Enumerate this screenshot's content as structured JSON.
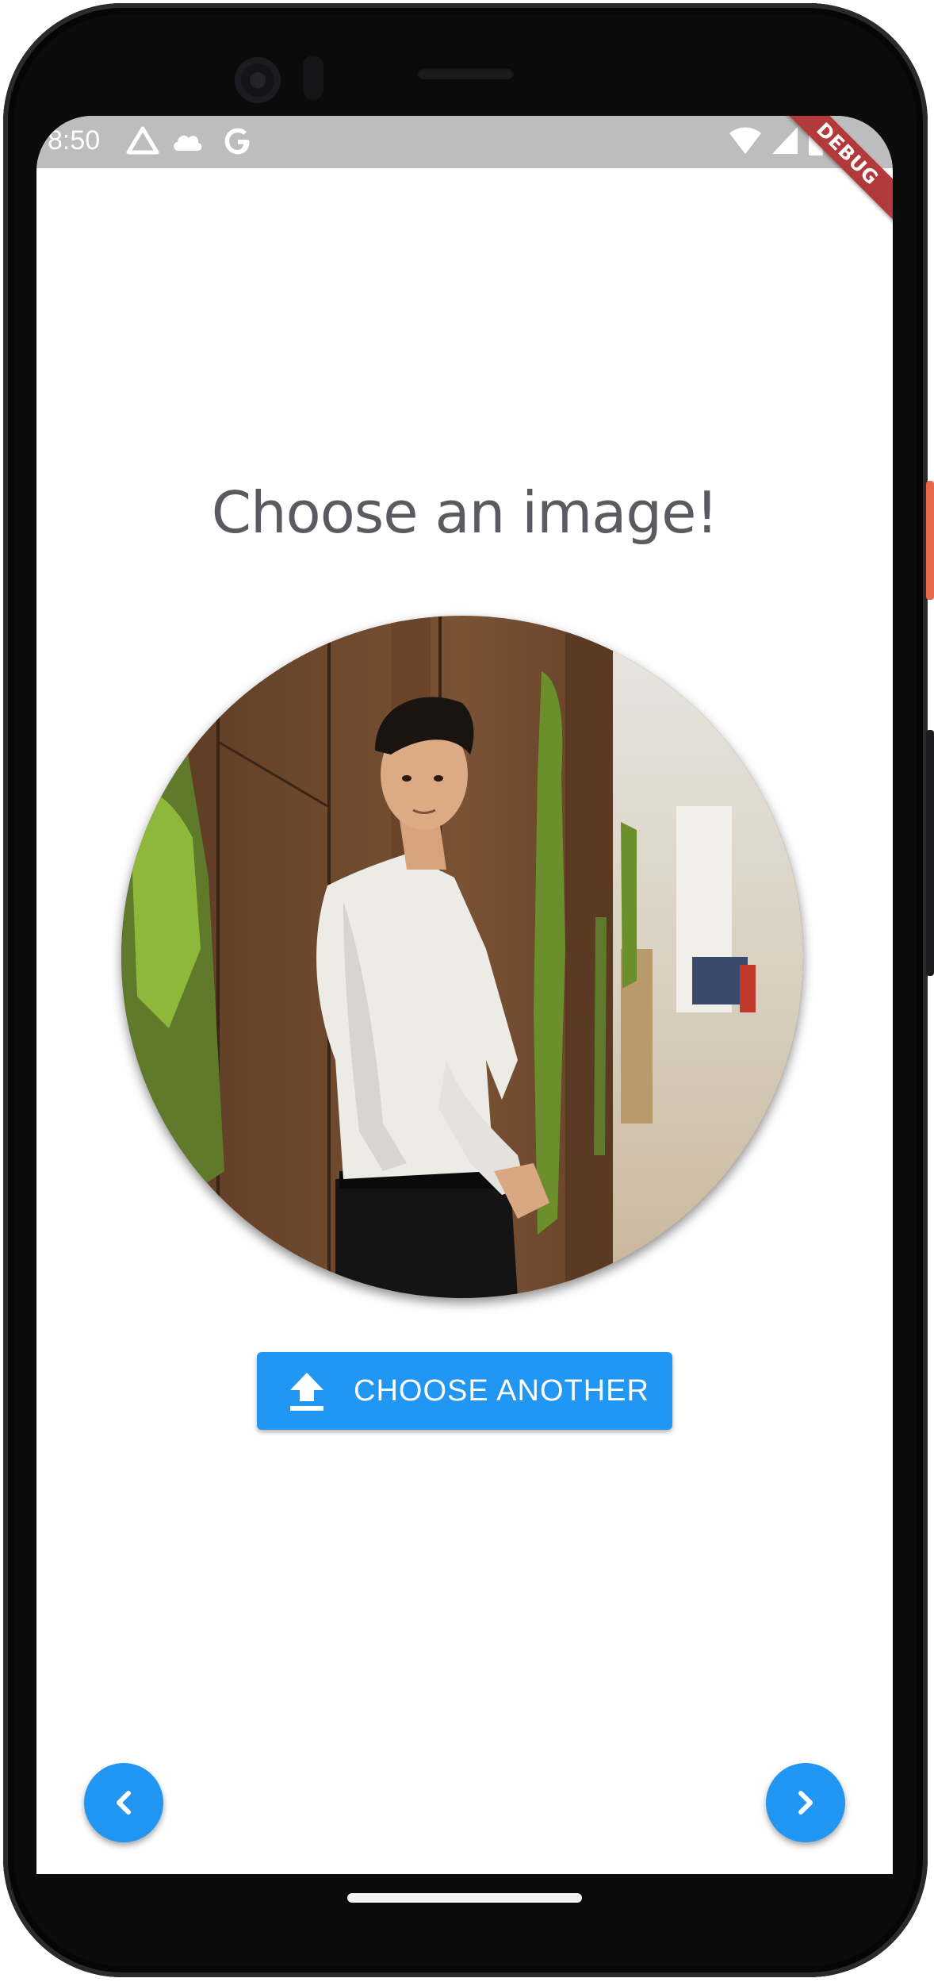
{
  "status_bar": {
    "time": "8:50",
    "left_icons": [
      "drive-icon",
      "cloud-icon",
      "google-icon"
    ],
    "right_icons": [
      "wifi-icon",
      "signal-icon",
      "battery-icon"
    ]
  },
  "debug_banner": "DEBUG",
  "page": {
    "title": "Choose an image!"
  },
  "image": {
    "description_name": "selected-photo"
  },
  "choose_button": {
    "icon": "upload-icon",
    "label": "CHOOSE ANOTHER"
  },
  "nav": {
    "prev_icon": "chevron-left-icon",
    "next_icon": "chevron-right-icon"
  },
  "colors": {
    "accent": "#2196f3",
    "title": "#595b60",
    "status_bar": "#bdbdbd",
    "debug_banner": "#b33a3a"
  }
}
